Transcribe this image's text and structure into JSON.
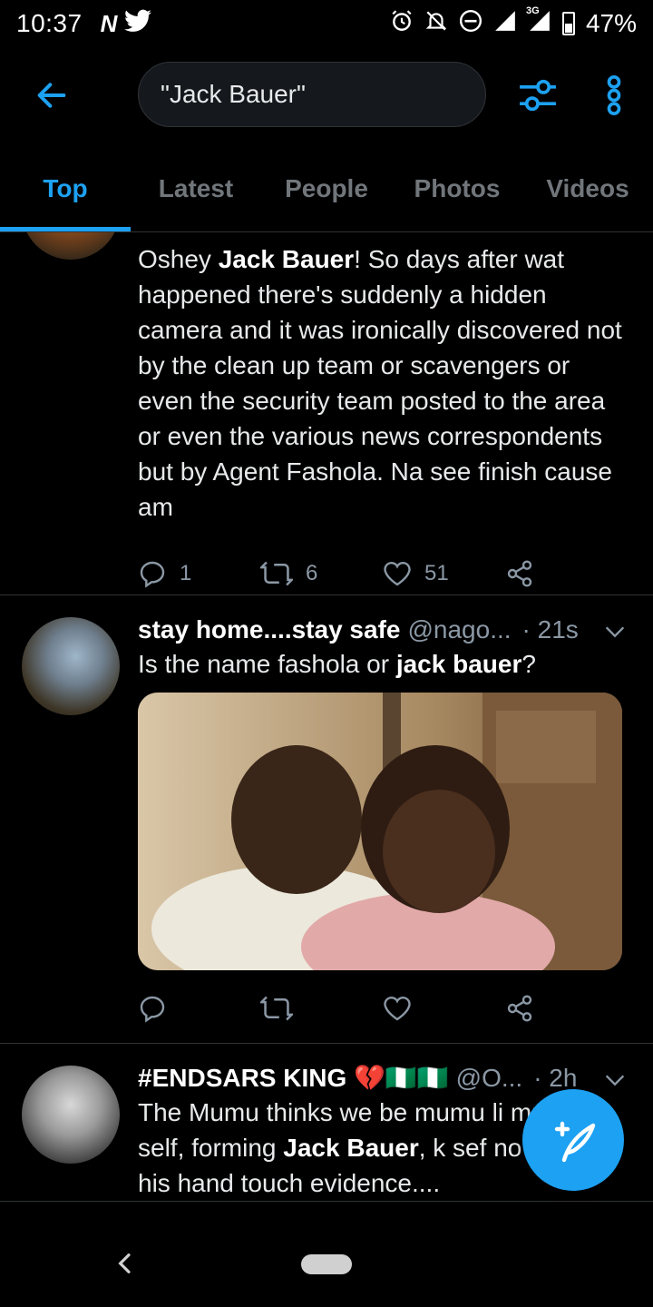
{
  "status_bar": {
    "time": "10:37",
    "left_icons": [
      "n-icon",
      "twitter-bird-icon"
    ],
    "right_icons": [
      "alarm-icon",
      "notifications-off-icon",
      "do-not-disturb-icon",
      "signal-icon",
      "signal-3g-icon"
    ],
    "network_label": "3G",
    "battery": "47%"
  },
  "header": {
    "search_query": "\"Jack Bauer\""
  },
  "tabs": [
    {
      "label": "Top",
      "active": true
    },
    {
      "label": "Latest",
      "active": false
    },
    {
      "label": "People",
      "active": false
    },
    {
      "label": "Photos",
      "active": false
    },
    {
      "label": "Videos",
      "active": false
    }
  ],
  "tweets": [
    {
      "segments": [
        {
          "text": "Oshey ",
          "bold": false
        },
        {
          "text": "Jack Bauer",
          "bold": true
        },
        {
          "text": "! So days after wat happened there's suddenly a hidden camera and it was ironically discovered not by the clean up team or scavengers or even the security team posted to the area or even the various news correspondents but by Agent Fashola. Na see finish cause am",
          "bold": false
        }
      ],
      "replies": "1",
      "retweets": "6",
      "likes": "51"
    },
    {
      "name": "stay home....stay safe",
      "handle": "@nago...",
      "time": "· 21s",
      "segments": [
        {
          "text": "Is the name fashola or ",
          "bold": false
        },
        {
          "text": "jack bauer",
          "bold": true
        },
        {
          "text": "?",
          "bold": false
        }
      ],
      "replies": "",
      "retweets": "",
      "likes": ""
    },
    {
      "name": "#ENDSARS KING 💔🇳🇬🇳🇬",
      "handle": "@O...",
      "time": "· 2h",
      "segments": [
        {
          "text": "The Mumu thinks we be mumu li",
          "bold": false
        },
        {
          "text": " mumu self, forming ",
          "bold": false
        },
        {
          "text": "Jack Bauer",
          "bold": true
        },
        {
          "text": ", ",
          "bold": false
        },
        {
          "text": "k sef no fit use his hand touch evidence....",
          "bold": false
        }
      ]
    }
  ],
  "colors": {
    "accent": "#1da1f2",
    "background": "#000000",
    "divider": "#2f3336",
    "secondary_text": "#8b98a5"
  }
}
